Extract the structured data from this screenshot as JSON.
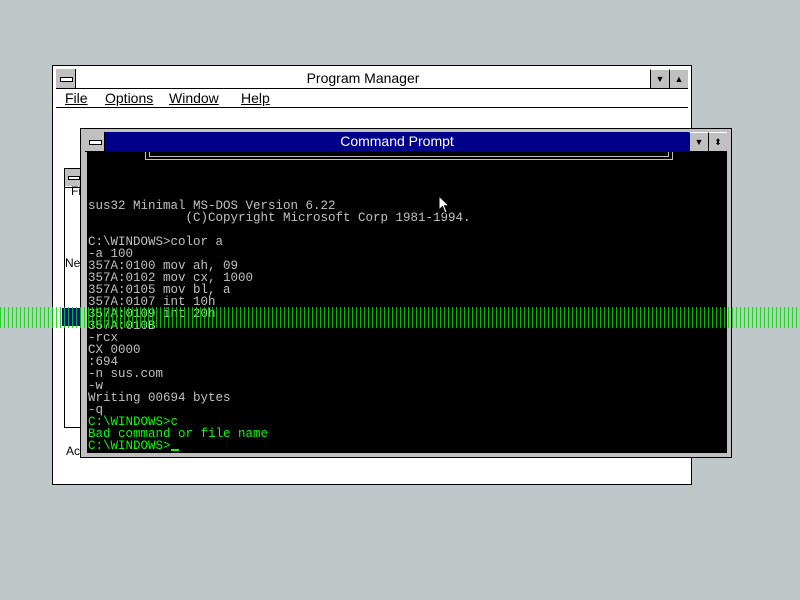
{
  "program_manager": {
    "title": "Program Manager",
    "menu": [
      {
        "label": "File"
      },
      {
        "label": "Options"
      },
      {
        "label": "Window"
      },
      {
        "label": "Help"
      }
    ],
    "background_labels": {
      "file": "File",
      "network": "Net",
      "accessories": "Acc"
    }
  },
  "command_prompt": {
    "title": "Command Prompt",
    "lines": [
      {
        "text": "",
        "color": "gray"
      },
      {
        "text": "sus32 Minimal MS-DOS Version 6.22",
        "color": "gray"
      },
      {
        "text": "             (C)Copyright Microsoft Corp 1981-1994.",
        "color": "gray"
      },
      {
        "text": "",
        "color": "gray"
      },
      {
        "text": "C:\\WINDOWS>color a",
        "color": "gray"
      },
      {
        "text": "-a 100",
        "color": "gray"
      },
      {
        "text": "357A:0100 mov ah, 09",
        "color": "gray"
      },
      {
        "text": "357A:0102 mov cx, 1000",
        "color": "gray"
      },
      {
        "text": "357A:0105 mov bl, a",
        "color": "gray"
      },
      {
        "text": "357A:0107 int 10h",
        "color": "gray"
      },
      {
        "text": "357A:0109 int 20h",
        "color": "gray"
      },
      {
        "text": "357A:010B",
        "color": "gray"
      },
      {
        "text": "-rcx",
        "color": "gray"
      },
      {
        "text": "CX 0000",
        "color": "gray"
      },
      {
        "text": ":694",
        "color": "gray"
      },
      {
        "text": "-n sus.com",
        "color": "gray"
      },
      {
        "text": "-w",
        "color": "gray"
      },
      {
        "text": "Writing 00694 bytes",
        "color": "gray"
      },
      {
        "text": "-q",
        "color": "gray"
      },
      {
        "text": "C:\\WINDOWS>c",
        "color": "green"
      },
      {
        "text": "Bad command or file name",
        "color": "green"
      },
      {
        "text": "",
        "color": "green"
      }
    ],
    "prompt": "C:\\WINDOWS>"
  },
  "colors": {
    "desktop": "#c0c7c8",
    "title_active": "#000088",
    "console_text": "#c0c0c0",
    "console_green": "#00ff00",
    "glitch": "#00d800"
  },
  "icons": {
    "system_menu": "system-menu-icon",
    "minimize": "triangle-down-icon",
    "maximize": "triangle-up-icon",
    "restore": "restore-icon",
    "pointer": "mouse-pointer-icon"
  }
}
